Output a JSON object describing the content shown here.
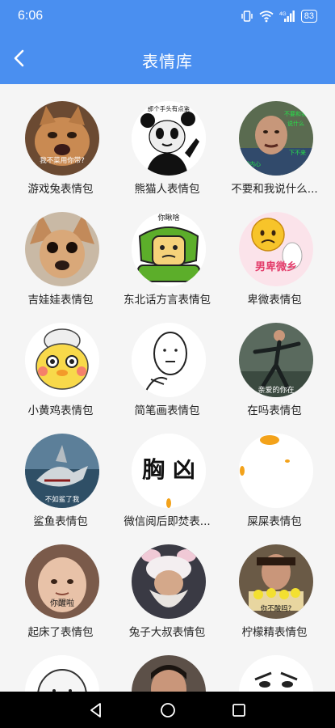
{
  "status": {
    "time": "6:06",
    "battery": "83"
  },
  "header": {
    "title": "表情库"
  },
  "packs": [
    {
      "label": "游戏兔表情包",
      "overlay": "我不菜用你带?",
      "icon": "crying-cat-image"
    },
    {
      "label": "熊猫人表情包",
      "overlay": "那个手头有点紧",
      "icon": "panda-man-image"
    },
    {
      "label": "不要和我说什么...",
      "overlay": "下不来",
      "icon": "man-with-green-text-image"
    },
    {
      "label": "吉娃娃表情包",
      "overlay": "",
      "icon": "chihuahua-image"
    },
    {
      "label": "东北话方言表情包",
      "overlay": "你瞅啥",
      "icon": "green-cartoon-image"
    },
    {
      "label": "卑微表情包",
      "overlay": "男卑微乡",
      "icon": "sad-yellow-face-image"
    },
    {
      "label": "小黄鸡表情包",
      "overlay": "",
      "icon": "yellow-chick-image"
    },
    {
      "label": "简笔画表情包",
      "overlay": "",
      "icon": "stick-figure-image"
    },
    {
      "label": "在吗表情包",
      "overlay": "亲爱的你在",
      "icon": "dancing-man-image"
    },
    {
      "label": "鲨鱼表情包",
      "overlay": "不如鲨了我",
      "icon": "shark-image"
    },
    {
      "label": "微信阅后即焚表...",
      "overlay": "胸 凶",
      "icon": "text-chest-image"
    },
    {
      "label": "屎屎表情包",
      "overlay": "",
      "icon": "orange-dots-image"
    },
    {
      "label": "起床了表情包",
      "overlay": "你醒啦",
      "icon": "baby-face-image"
    },
    {
      "label": "兔子大叔表情包",
      "overlay": "",
      "icon": "bunny-hat-man-image"
    },
    {
      "label": "柠檬精表情包",
      "overlay": "你不酸吗?",
      "icon": "lemon-man-image"
    },
    {
      "label": "",
      "overlay": "",
      "icon": "round-face-image"
    },
    {
      "label": "",
      "overlay": "",
      "icon": "boy-image"
    },
    {
      "label": "",
      "overlay": "",
      "icon": "sketch-face-image"
    }
  ]
}
